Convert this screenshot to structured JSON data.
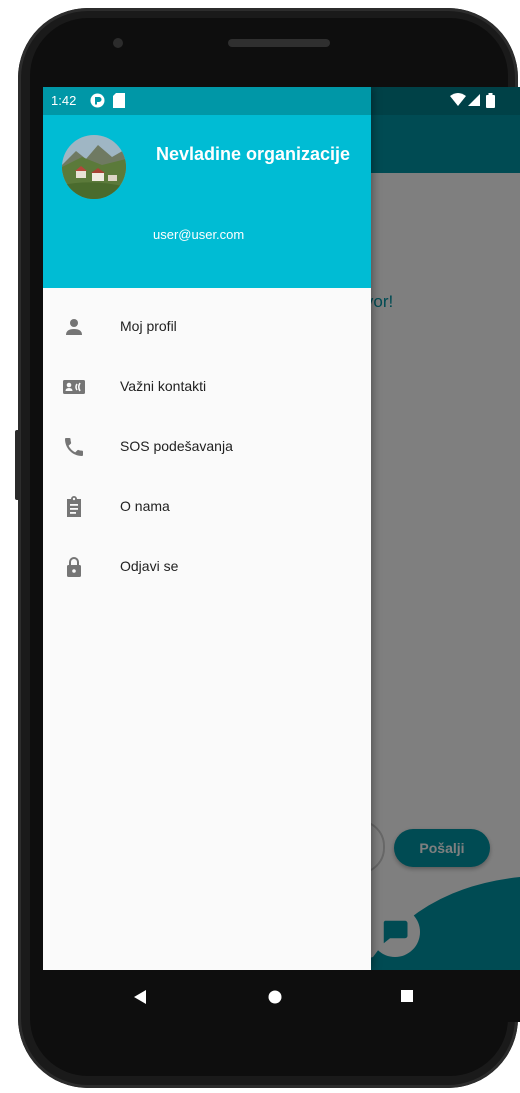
{
  "status_bar": {
    "time": "1:42",
    "left_icons": [
      "sync-icon",
      "sd-card-icon"
    ],
    "right_icons": [
      "wifi-icon",
      "signal-icon",
      "battery-icon"
    ]
  },
  "drawer": {
    "header": {
      "organization_name": "Nevladine organizacije",
      "email": "user@user.com",
      "avatar": "mountain-village-photo"
    },
    "menu_items": [
      {
        "label": "Moj profil",
        "icon": "person-icon"
      },
      {
        "label": "Važni kontakti",
        "icon": "contact-card-icon"
      },
      {
        "label": "SOS podešavanja",
        "icon": "phone-icon"
      },
      {
        "label": "O nama",
        "icon": "clipboard-icon"
      },
      {
        "label": "Odjavi se",
        "icon": "lock-icon"
      }
    ]
  },
  "background": {
    "partial_text": "govor!",
    "send_button_label": "Pošalji"
  },
  "nav_bar": {
    "buttons": [
      "back-icon",
      "home-icon",
      "recents-icon"
    ]
  },
  "colors": {
    "accent": "#00bcd4",
    "accent_dark": "#0097a7",
    "status_dark": "#00838f"
  }
}
